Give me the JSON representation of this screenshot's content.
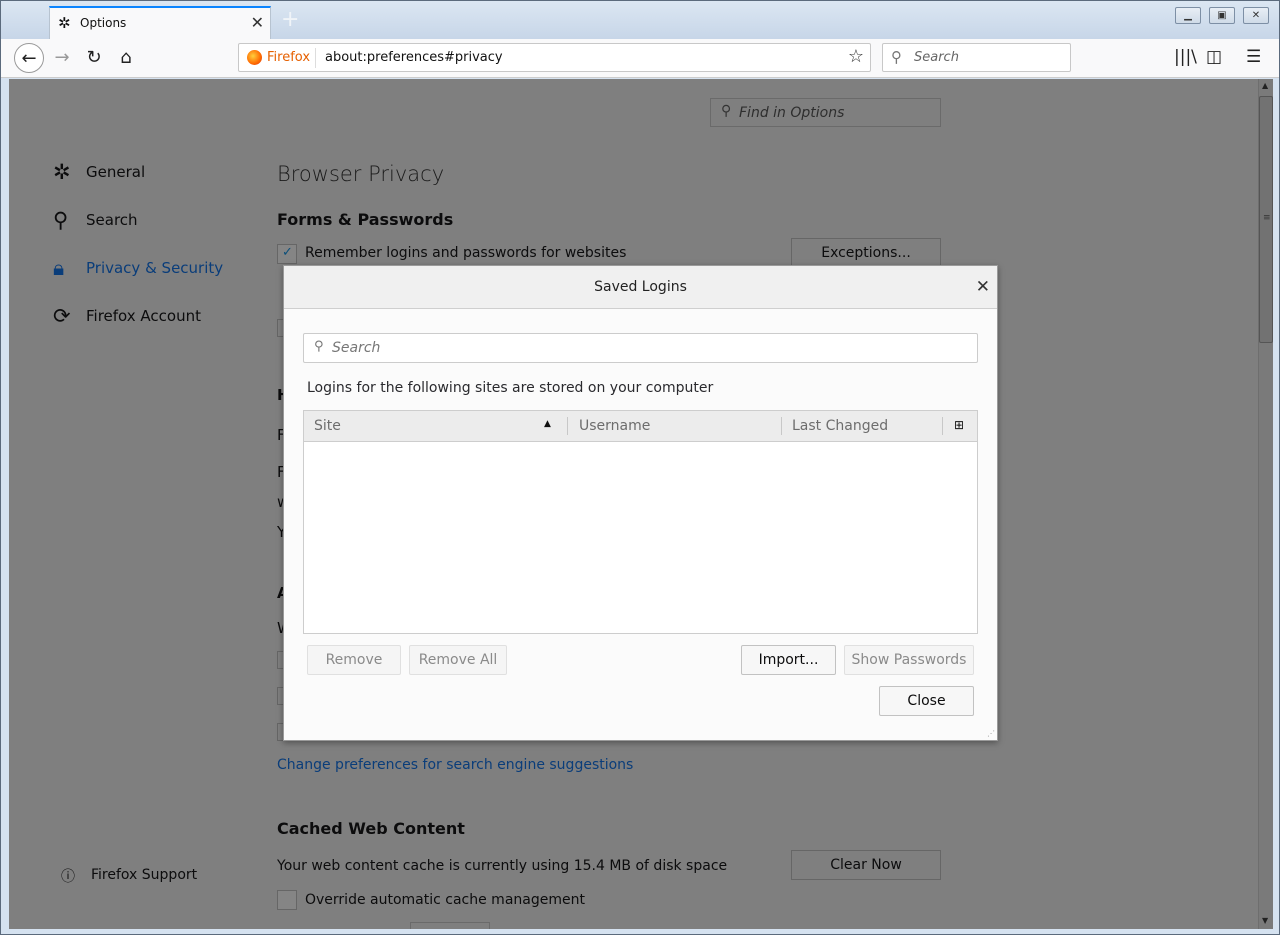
{
  "window": {
    "tab": {
      "icon": "gear-icon",
      "title": "Options"
    },
    "new_tab_label": "+",
    "controls": {
      "minimize": "▭",
      "maximize": "▣",
      "close": "✕"
    }
  },
  "navbar": {
    "url_identity_label": "Firefox",
    "url": "about:preferences#privacy",
    "search_placeholder": "Search"
  },
  "preferences": {
    "find_placeholder": "Find in Options",
    "categories": [
      {
        "icon": "gear-icon",
        "label": "General",
        "active": false
      },
      {
        "icon": "search-icon",
        "label": "Search",
        "active": false
      },
      {
        "icon": "lock-icon",
        "label": "Privacy & Security",
        "active": true
      },
      {
        "icon": "sync-icon",
        "label": "Firefox Account",
        "active": false
      }
    ],
    "support_label": "Firefox Support",
    "page_title": "Browser Privacy",
    "forms_heading": "Forms & Passwords",
    "remember_logins_label": "Remember logins and passwords for websites",
    "remember_logins_checked": true,
    "exceptions_button": "Exceptions...",
    "partial_letters": [
      "H",
      "F",
      "F",
      "w",
      "Y",
      "A",
      "W"
    ],
    "search_suggestions_link": "Change preferences for search engine suggestions",
    "cache_heading": "Cached Web Content",
    "cache_usage_text": "Your web content cache is currently using 15.4 MB of disk space",
    "clear_now_button": "Clear Now",
    "override_cache_label": "Override automatic cache management",
    "override_cache_checked": false
  },
  "dialog": {
    "title": "Saved Logins",
    "search_placeholder": "Search",
    "description": "Logins for the following sites are stored on your computer",
    "columns": [
      {
        "label": "Site",
        "sorted": "ascending"
      },
      {
        "label": "Username"
      },
      {
        "label": "Last Changed"
      }
    ],
    "rows": [],
    "buttons": {
      "remove": "Remove",
      "remove_all": "Remove All",
      "import": "Import...",
      "show_passwords": "Show Passwords",
      "close": "Close"
    }
  },
  "colors": {
    "accent": "#0a84ff",
    "link": "#0a3d7a",
    "overlay": "#7f7f7f"
  }
}
